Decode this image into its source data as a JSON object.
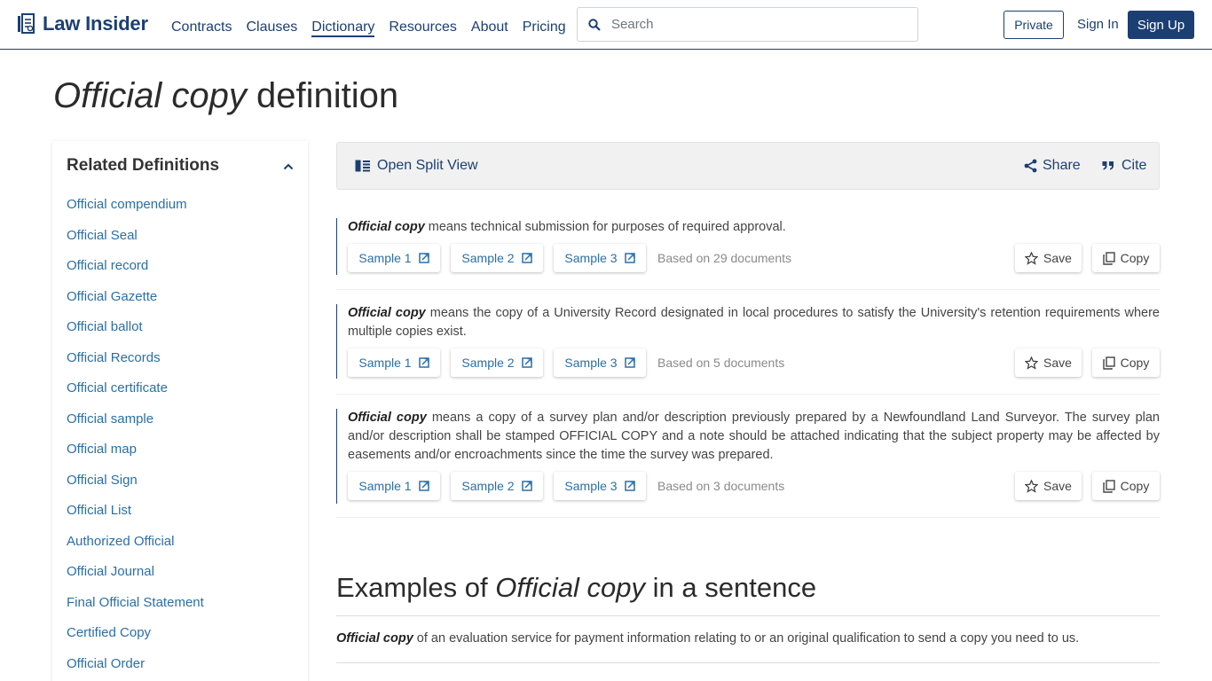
{
  "header": {
    "logo_text": "Law Insider",
    "nav": [
      {
        "label": "Contracts",
        "active": false
      },
      {
        "label": "Clauses",
        "active": false
      },
      {
        "label": "Dictionary",
        "active": true
      },
      {
        "label": "Resources",
        "active": false
      },
      {
        "label": "About",
        "active": false
      },
      {
        "label": "Pricing",
        "active": false
      }
    ],
    "search_placeholder": "Search",
    "private_label": "Private",
    "signin_label": "Sign In",
    "signup_label": "Sign Up"
  },
  "title": {
    "term": "Official copy",
    "suffix": "definition"
  },
  "sidebar": {
    "heading": "Related Definitions",
    "items": [
      "Official compendium",
      "Official Seal",
      "Official record",
      "Official Gazette",
      "Official ballot",
      "Official Records",
      "Official certificate",
      "Official sample",
      "Official map",
      "Official Sign",
      "Official List",
      "Authorized Official",
      "Official Journal",
      "Final Official Statement",
      "Certified Copy",
      "Official Order"
    ]
  },
  "toolbar": {
    "split_label": "Open Split View",
    "share_label": "Share",
    "cite_label": "Cite"
  },
  "definitions": [
    {
      "term": "Official copy",
      "text": " means technical submission for purposes of required approval.",
      "samples": [
        "Sample 1",
        "Sample 2",
        "Sample 3"
      ],
      "based_on": "Based on 29 documents"
    },
    {
      "term": "Official copy",
      "text": " means the copy of a University Record designated in local procedures to satisfy the University's retention requirements where multiple copies exist.",
      "samples": [
        "Sample 1",
        "Sample 2",
        "Sample 3"
      ],
      "based_on": "Based on 5 documents"
    },
    {
      "term": "Official copy",
      "text": " means a copy of a survey plan and/or description previously prepared by a Newfoundland Land Surveyor. The survey plan and/or description shall be stamped OFFICIAL COPY and a note should be attached indicating that the subject property may be affected by easements and/or encroachments since the time the survey was prepared.",
      "samples": [
        "Sample 1",
        "Sample 2",
        "Sample 3"
      ],
      "based_on": "Based on 3 documents"
    }
  ],
  "actions": {
    "save_label": "Save",
    "copy_label": "Copy"
  },
  "examples": {
    "prefix": "Examples of ",
    "term": "Official copy",
    "suffix": " in a sentence",
    "sentence_term": "Official copy",
    "sentence_text": " of an evaluation service for payment information relating to or an original qualification to send a copy you need to us."
  },
  "colors": {
    "brand": "#1c3f73",
    "link": "#2a6fa8"
  }
}
